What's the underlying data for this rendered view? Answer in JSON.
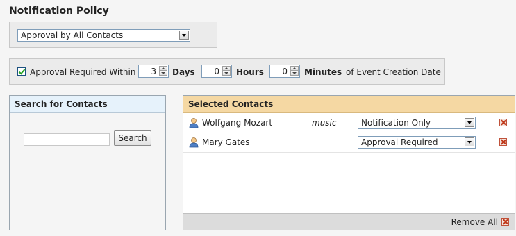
{
  "title": "Notification Policy",
  "policy": {
    "selected": "Approval by All Contacts"
  },
  "approval": {
    "checked": true,
    "label": "Approval Required Within",
    "days": {
      "value": "3",
      "unit": "Days"
    },
    "hours": {
      "value": "0",
      "unit": "Hours"
    },
    "minutes": {
      "value": "0",
      "unit": "Minutes"
    },
    "suffix": "of Event Creation Date"
  },
  "search_panel": {
    "header": "Search for Contacts",
    "input_value": "",
    "button_label": "Search"
  },
  "selected_panel": {
    "header": "Selected Contacts",
    "contacts": [
      {
        "name": "Wolfgang Mozart",
        "tag": "music",
        "role": "Notification Only",
        "icon": "person-icon"
      },
      {
        "name": "Mary Gates",
        "tag": "",
        "role": "Approval Required",
        "icon": "person-icon"
      }
    ],
    "remove_all_label": "Remove All"
  }
}
